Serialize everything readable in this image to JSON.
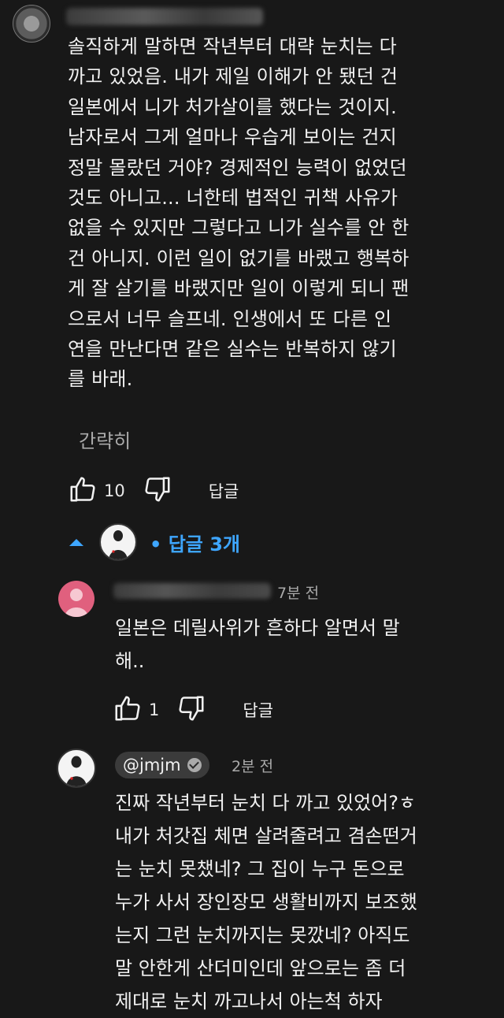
{
  "comment": {
    "text": "솔직하게 말하면 작년부터 대략 눈치는 다\n까고 있었음. 내가 제일 이해가 안 됐던 건\n일본에서 니가 처가살이를 했다는 것이지.\n남자로서 그게 얼마나 우습게 보이는 건지\n정말 몰랐던 거야? 경제적인 능력이 없었던\n것도 아니고...   너한테 법적인 귀책 사유가\n없을 수 있지만 그렇다고 니가 실수를 안 한\n건 아니지.  이런 일이 없기를 바랬고 행복하\n게 잘 살기를 바랬지만 일이 이렇게 되니 팬\n으로서  너무 슬프네.  인생에서 또 다른 인\n연을 만난다면 같은 실수는 반복하지 않기\n를 바래.",
    "collapse_label": "간략히",
    "like_count": "10",
    "reply_label": "답글"
  },
  "replies_toggle": {
    "label": "• 답글 3개"
  },
  "replies": [
    {
      "time": "7분 전",
      "text": "일본은 데릴사위가 흔하다 알면서 말\n해..",
      "like_count": "1",
      "reply_label": "답글"
    },
    {
      "channel": "@jmjm",
      "time": "2분 전",
      "text": "진짜 작년부터 눈치 다 까고 있었어?ㅎ\n내가 처갓집 체면 살려줄려고 겸손떤거\n는 눈치 못챘네? 그 집이 누구 돈으로\n누가 사서 장인장모 생활비까지 보조했\n는지 그런 눈치까지는 못깠네? 아직도\n말 안한게 산더미인데 앞으로는 좀 더\n제대로 눈치 까고나서 아는척 하자"
    }
  ],
  "colors": {
    "background": "#181818",
    "text": "#f1f1f1",
    "secondary": "#aaaaaa",
    "link": "#3ea6ff",
    "avatar_pink": "#e0607e"
  },
  "icons": [
    "thumbs-up-icon",
    "thumbs-down-icon",
    "chevron-up-icon",
    "verified-check-icon"
  ]
}
